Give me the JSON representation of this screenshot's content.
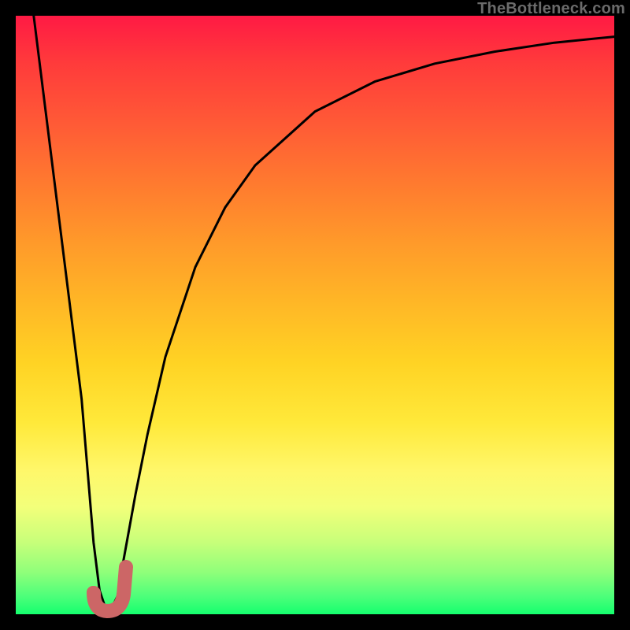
{
  "watermark": "TheBottleneck.com",
  "chart_data": {
    "type": "line",
    "title": "",
    "xlabel": "",
    "ylabel": "",
    "xlim": [
      0,
      100
    ],
    "ylim": [
      0,
      100
    ],
    "grid": false,
    "series": [
      {
        "name": "bottleneck-curve",
        "color": "#000000",
        "x": [
          3,
          5,
          7,
          9,
          11,
          12,
          13,
          14,
          15,
          16,
          17,
          18,
          20,
          22,
          25,
          30,
          35,
          40,
          50,
          60,
          70,
          80,
          90,
          100
        ],
        "y": [
          100,
          84,
          68,
          52,
          36,
          24,
          12,
          4,
          1,
          1,
          3,
          9,
          20,
          30,
          43,
          58,
          68,
          75,
          84,
          89,
          92,
          94,
          95.5,
          96.5
        ]
      },
      {
        "name": "optimal-marker",
        "color": "#cc6666",
        "type": "marker",
        "shape": "j-hook",
        "x_center": 15,
        "y_center": 2
      }
    ],
    "annotations": []
  },
  "colors": {
    "background": "#000000",
    "curve": "#000000",
    "marker": "#cc6666",
    "gradient_top": "#ff1a44",
    "gradient_bottom": "#15ff6e"
  }
}
